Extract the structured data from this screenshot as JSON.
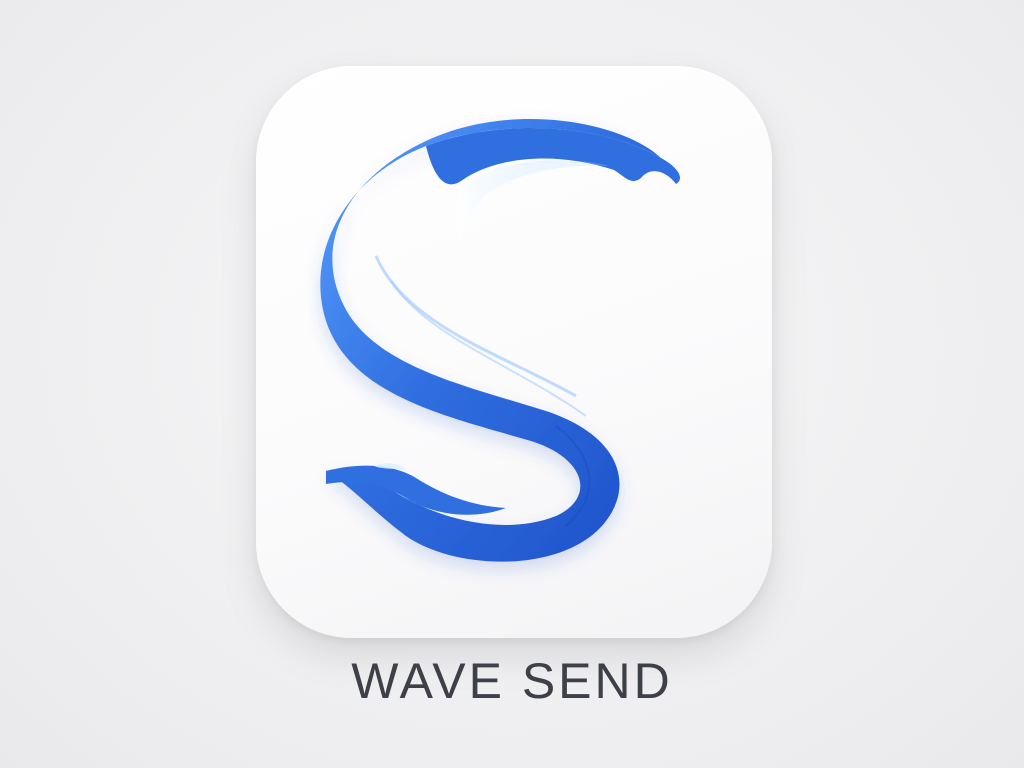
{
  "app": {
    "name": "WAVE SEND",
    "icon": "wave-s-logo-icon"
  },
  "colors": {
    "background": "#eeeef0",
    "icon_tile": "#ffffff",
    "wave_primary": "#2f6fe0",
    "wave_deep": "#1f4fc8",
    "wave_light": "#7fb6ff",
    "wordmark": "#3e4048"
  }
}
